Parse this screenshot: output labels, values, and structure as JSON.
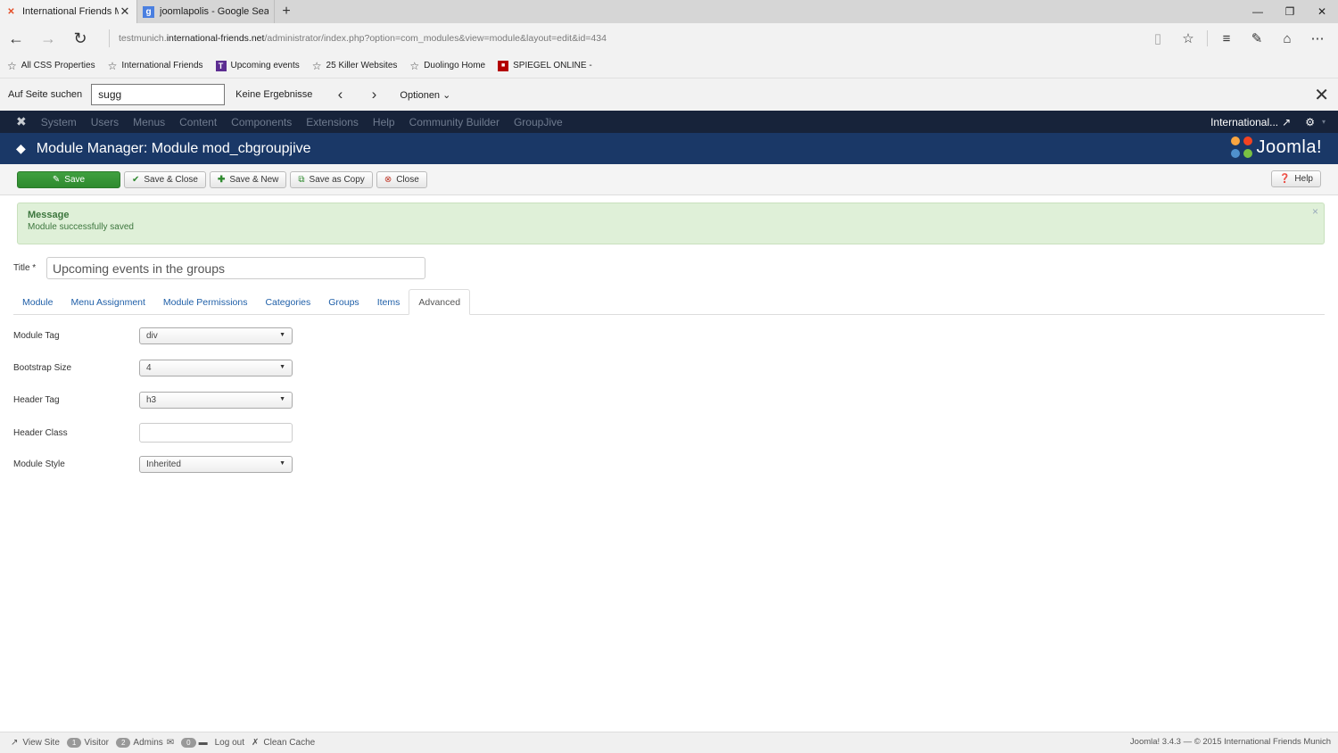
{
  "browser": {
    "tabs": [
      {
        "title": "International Friends Mu",
        "active": true
      },
      {
        "title": "joomlapolis - Google Search",
        "active": false
      }
    ],
    "url_prefix": "testmunich.",
    "url_domain": "international-friends.net",
    "url_path": "/administrator/index.php?option=com_modules&view=module&layout=edit&id=434",
    "favorites": [
      {
        "label": "All CSS Properties",
        "icon": "star-icon"
      },
      {
        "label": "International Friends",
        "icon": "star-icon"
      },
      {
        "label": "Upcoming events",
        "icon": "purple-t-icon"
      },
      {
        "label": "25 Killer Websites",
        "icon": "star-icon"
      },
      {
        "label": "Duolingo  Home",
        "icon": "star-icon"
      },
      {
        "label": "SPIEGEL ONLINE -",
        "icon": "spiegel-icon"
      }
    ],
    "find": {
      "label": "Auf Seite suchen",
      "value": "sugg",
      "result": "Keine Ergebnisse",
      "options": "Optionen"
    }
  },
  "joomla": {
    "menu": [
      "System",
      "Users",
      "Menus",
      "Content",
      "Components",
      "Extensions",
      "Help",
      "Community Builder",
      "GroupJive"
    ],
    "site_name": "International...",
    "page_title": "Module Manager: Module mod_cbgroupjive",
    "brand": "Joomla!",
    "toolbar": {
      "save": "Save",
      "save_close": "Save & Close",
      "save_new": "Save & New",
      "save_copy": "Save as Copy",
      "close": "Close",
      "help": "Help"
    },
    "alert": {
      "heading": "Message",
      "text": "Module successfully saved",
      "close": "×"
    },
    "title_label": "Title *",
    "title_value": "Upcoming events in the groups",
    "tabs": [
      "Module",
      "Menu Assignment",
      "Module Permissions",
      "Categories",
      "Groups",
      "Items",
      "Advanced"
    ],
    "active_tab": "Advanced",
    "fields": [
      {
        "label": "Module Tag",
        "value": "div"
      },
      {
        "label": "Bootstrap Size",
        "value": "4"
      },
      {
        "label": "Header Tag",
        "value": "h3"
      },
      {
        "label": "Header Class",
        "value": ""
      },
      {
        "label": "Module Style",
        "value": "Inherited"
      }
    ],
    "status": {
      "view_site": "View Site",
      "visitors_count": "1",
      "visitors_label": "Visitor",
      "admins_count": "2",
      "admins_label": "Admins",
      "messages_count": "0",
      "logout": "Log out",
      "clean_cache": "Clean Cache",
      "footer": "Joomla! 3.4.3  —  © 2015 International Friends Munich"
    }
  },
  "colors": {
    "nav_bg": "#17233a",
    "title_bg": "#1a3867",
    "save_green": "#2f8a2f",
    "alert_bg": "#dff0d8",
    "link_blue": "#1f5fa8"
  }
}
